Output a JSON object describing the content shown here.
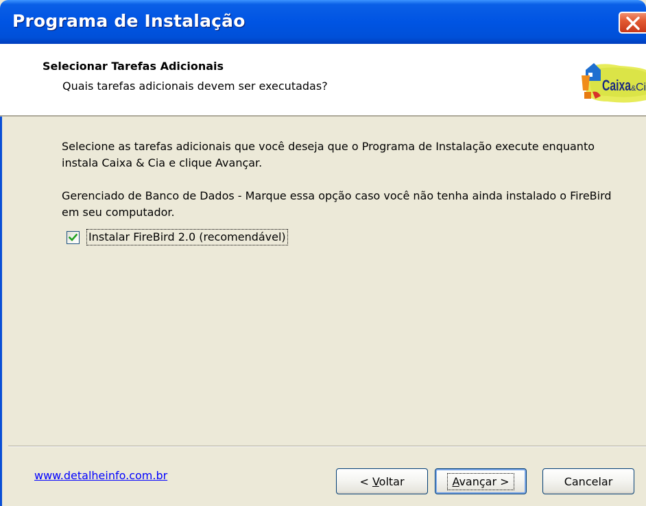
{
  "window": {
    "title": "Programa de Instalação",
    "close_icon": "close-x-icon"
  },
  "header": {
    "title": "Selecionar Tarefas Adicionais",
    "subtitle": "Quais tarefas adicionais devem ser executadas?",
    "logo_text_main": "Caixa",
    "logo_text_amp": "&",
    "logo_text_tail": "Cia"
  },
  "body": {
    "intro": "Selecione as tarefas adicionais que você deseja que o Programa de Instalação execute enquanto instala Caixa & Cia e clique Avançar.",
    "group_description": "Gerenciado de Banco de Dados - Marque essa opção caso você não tenha ainda instalado o FireBird em seu computador.",
    "task": {
      "label": "Instalar FireBird 2.0 (recomendável)",
      "checked": true
    }
  },
  "footer": {
    "link": "www.detalheinfo.com.br",
    "back": {
      "prefix": "< ",
      "accel": "V",
      "rest": "oltar"
    },
    "next": {
      "accel": "A",
      "rest": "vançar >"
    },
    "cancel": "Cancelar"
  },
  "colors": {
    "titlebar": "#0054e3",
    "dialog_bg": "#ece9d8",
    "link": "#0000ff",
    "checkmark": "#21a121"
  }
}
